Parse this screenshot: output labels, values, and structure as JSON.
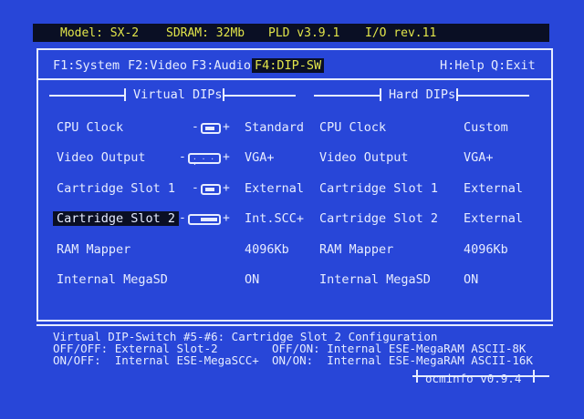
{
  "topbar": {
    "model": "Model: SX-2",
    "sdram": "SDRAM: 32Mb",
    "pld": "PLD v3.9.1",
    "io": "I/O rev.11"
  },
  "menu": {
    "items": [
      {
        "label": "F1:System",
        "selected": false
      },
      {
        "label": "F2:Video",
        "selected": false
      },
      {
        "label": "F3:Audio",
        "selected": false
      },
      {
        "label": "F4:DIP-SW",
        "selected": true
      }
    ],
    "help": "H:Help",
    "exit": "Q:Exit"
  },
  "sections": {
    "virtual": "Virtual DIPs",
    "hard": "Hard DIPs"
  },
  "virtual_rows": [
    {
      "label": "CPU Clock",
      "switch": "single",
      "value": "Standard"
    },
    {
      "label": "Video Output",
      "switch": "dots",
      "value": "VGA+"
    },
    {
      "label": "Cartridge Slot 1",
      "switch": "single",
      "value": "External"
    },
    {
      "label": "Cartridge Slot 2",
      "switch": "double",
      "value": "Int.SCC+",
      "highlighted": true
    },
    {
      "label": "RAM Mapper",
      "switch": "none",
      "value": "4096Kb"
    },
    {
      "label": "Internal MegaSD",
      "switch": "none",
      "value": "ON"
    }
  ],
  "hard_rows": [
    {
      "label": "CPU Clock",
      "value": "Custom"
    },
    {
      "label": "Video Output",
      "value": "VGA+"
    },
    {
      "label": "Cartridge Slot 1",
      "value": "External"
    },
    {
      "label": "Cartridge Slot 2",
      "value": "External"
    },
    {
      "label": "RAM Mapper",
      "value": "4096Kb"
    },
    {
      "label": "Internal MegaSD",
      "value": "ON"
    }
  ],
  "switch_signs": {
    "minus": "-",
    "plus": "+"
  },
  "info": {
    "title": "Virtual DIP-Switch #5-#6: Cartridge Slot 2 Configuration",
    "line1_left": "OFF/OFF: External Slot-2",
    "line1_right": "OFF/ON: Internal ESE-MegaRAM ASCII-8K",
    "line2_left": "ON/OFF:  Internal ESE-MegaSCC+",
    "line2_right": "ON/ON:  Internal ESE-MegaRAM ASCII-16K"
  },
  "version": "ocminfo v0.9.4",
  "colors": {
    "background": "#2846d8",
    "text": "#e6ecff",
    "bar": "#0a0f24",
    "accent": "#e2e54a"
  }
}
